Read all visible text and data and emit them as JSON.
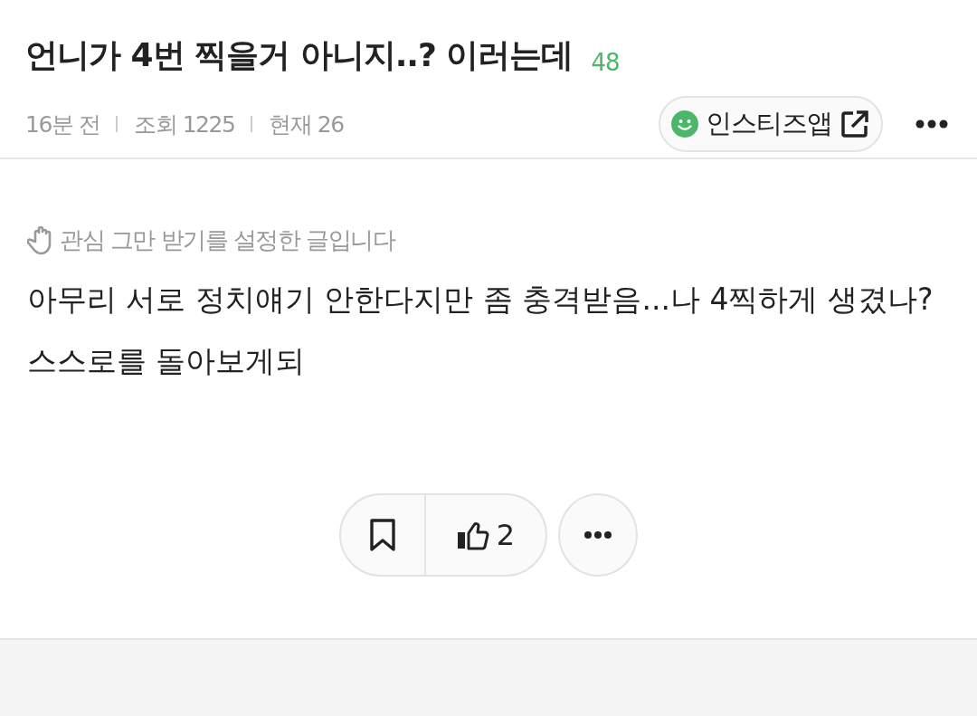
{
  "post": {
    "title": "언니가 4번 찍을거 아니지..? 이러는데",
    "comment_count": "48",
    "time": "16분 전",
    "views": "조회 1225",
    "current": "현재 26",
    "app_link": "인스티즈앱"
  },
  "notice": "관심 그만 받기를 설정한 글입니다",
  "body": "아무리 서로 정치얘기 안한다지만 좀 충격받음...나 4찍하게 생겼나? 스스로를 돌아보게되",
  "actions": {
    "likes": "2",
    "bookmarked": false
  }
}
